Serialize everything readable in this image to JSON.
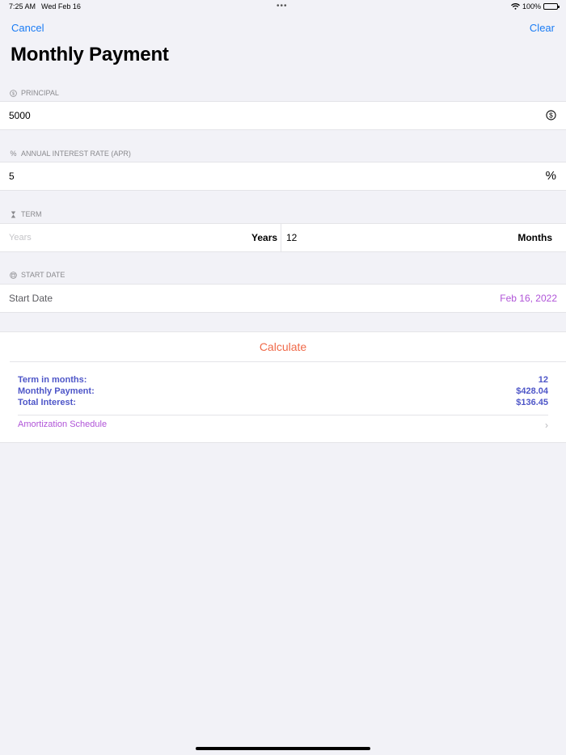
{
  "status_bar": {
    "time": "7:25 AM",
    "date": "Wed Feb 16",
    "multitasking_dots": "•••",
    "battery": "100%",
    "wifi_icon": "wifi-icon",
    "battery_icon": "battery-full-icon"
  },
  "nav": {
    "cancel_label": "Cancel",
    "clear_label": "Clear",
    "title": "Monthly Payment"
  },
  "principal": {
    "header": "PRINCIPAL",
    "header_icon": "dollar-circle-icon",
    "value": "5000",
    "trailing_icon": "dollar-circle-icon"
  },
  "interest": {
    "header": "ANNUAL INTEREST RATE (APR)",
    "header_icon": "percent-icon",
    "header_glyph": "%",
    "value": "5",
    "trailing_symbol": "%"
  },
  "term": {
    "header": "TERM",
    "header_icon": "hourglass-icon",
    "years_placeholder": "Years",
    "years_label": "Years",
    "months_value": "12",
    "months_label": "Months"
  },
  "start_date": {
    "header": "START DATE",
    "header_icon": "calendar-icon",
    "label": "Start Date",
    "value": "Feb 16, 2022"
  },
  "results": {
    "calculate_label": "Calculate",
    "term_label": "Term in months:",
    "term_value": "12",
    "payment_label": "Monthly Payment:",
    "payment_value": "$428.04",
    "interest_label": "Total Interest:",
    "interest_value": "$136.45",
    "amortization_label": "Amortization Schedule",
    "chevron": "›"
  },
  "colors": {
    "accent_blue": "#1a7cf5",
    "calculate_orange": "#f06a4a",
    "result_indigo": "#4e56c8",
    "date_purple": "#b054d8",
    "background": "#f2f2f7"
  }
}
